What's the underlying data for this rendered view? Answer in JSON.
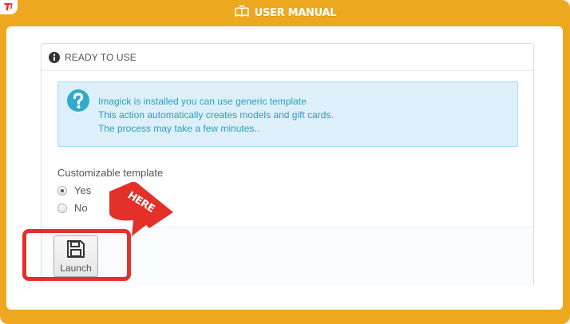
{
  "header": {
    "title": "USER MANUAL",
    "icon": "book-icon"
  },
  "panel": {
    "title": "READY TO USE",
    "title_icon": "info-circle-icon"
  },
  "alert": {
    "icon": "question-circle-icon",
    "lines": [
      "Imagick is installed you can use generic template",
      "This action automatically creates models and gift cards.",
      "The process may take a few minutes.."
    ]
  },
  "form": {
    "label": "Customizable template",
    "options": [
      {
        "label": "Yes",
        "selected": true
      },
      {
        "label": "No",
        "selected": false
      }
    ]
  },
  "launch_button": {
    "label": "Launch",
    "icon": "floppy-disk-icon"
  },
  "annotation": {
    "tag_text": "HERE",
    "color": "#e3312a"
  },
  "colors": {
    "frame": "#eda820",
    "alert_bg": "#ddf0fa",
    "alert_text": "#2a9dc1",
    "highlight": "#e3312a"
  }
}
